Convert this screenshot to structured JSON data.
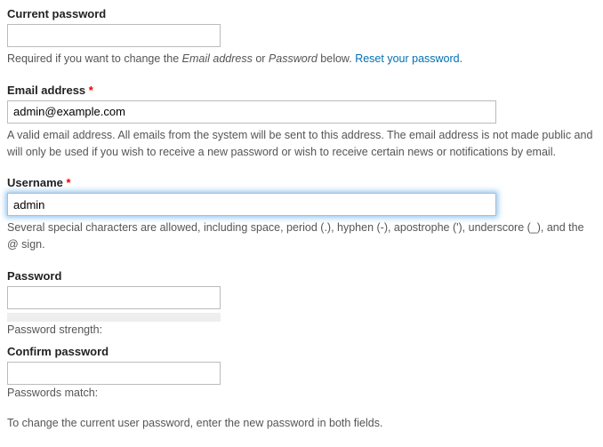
{
  "current_password": {
    "label": "Current password",
    "value": "",
    "description_prefix": "Required if you want to change the ",
    "em1": "Email address",
    "mid": " or ",
    "em2": "Password",
    "suffix": " below. ",
    "link_text": "Reset your password",
    "period": "."
  },
  "email": {
    "label": "Email address",
    "value": "admin@example.com",
    "description": "A valid email address. All emails from the system will be sent to this address. The email address is not made public and will only be used if you wish to receive a new password or wish to receive certain news or notifications by email."
  },
  "username": {
    "label": "Username",
    "value": "admin",
    "description": "Several special characters are allowed, including space, period (.), hyphen (-), apostrophe ('), underscore (_), and the @ sign."
  },
  "password": {
    "label": "Password",
    "value": "",
    "strength_label": "Password strength:"
  },
  "confirm_password": {
    "label": "Confirm password",
    "value": "",
    "match_label": "Passwords match:"
  },
  "footer_note": "To change the current user password, enter the new password in both fields."
}
